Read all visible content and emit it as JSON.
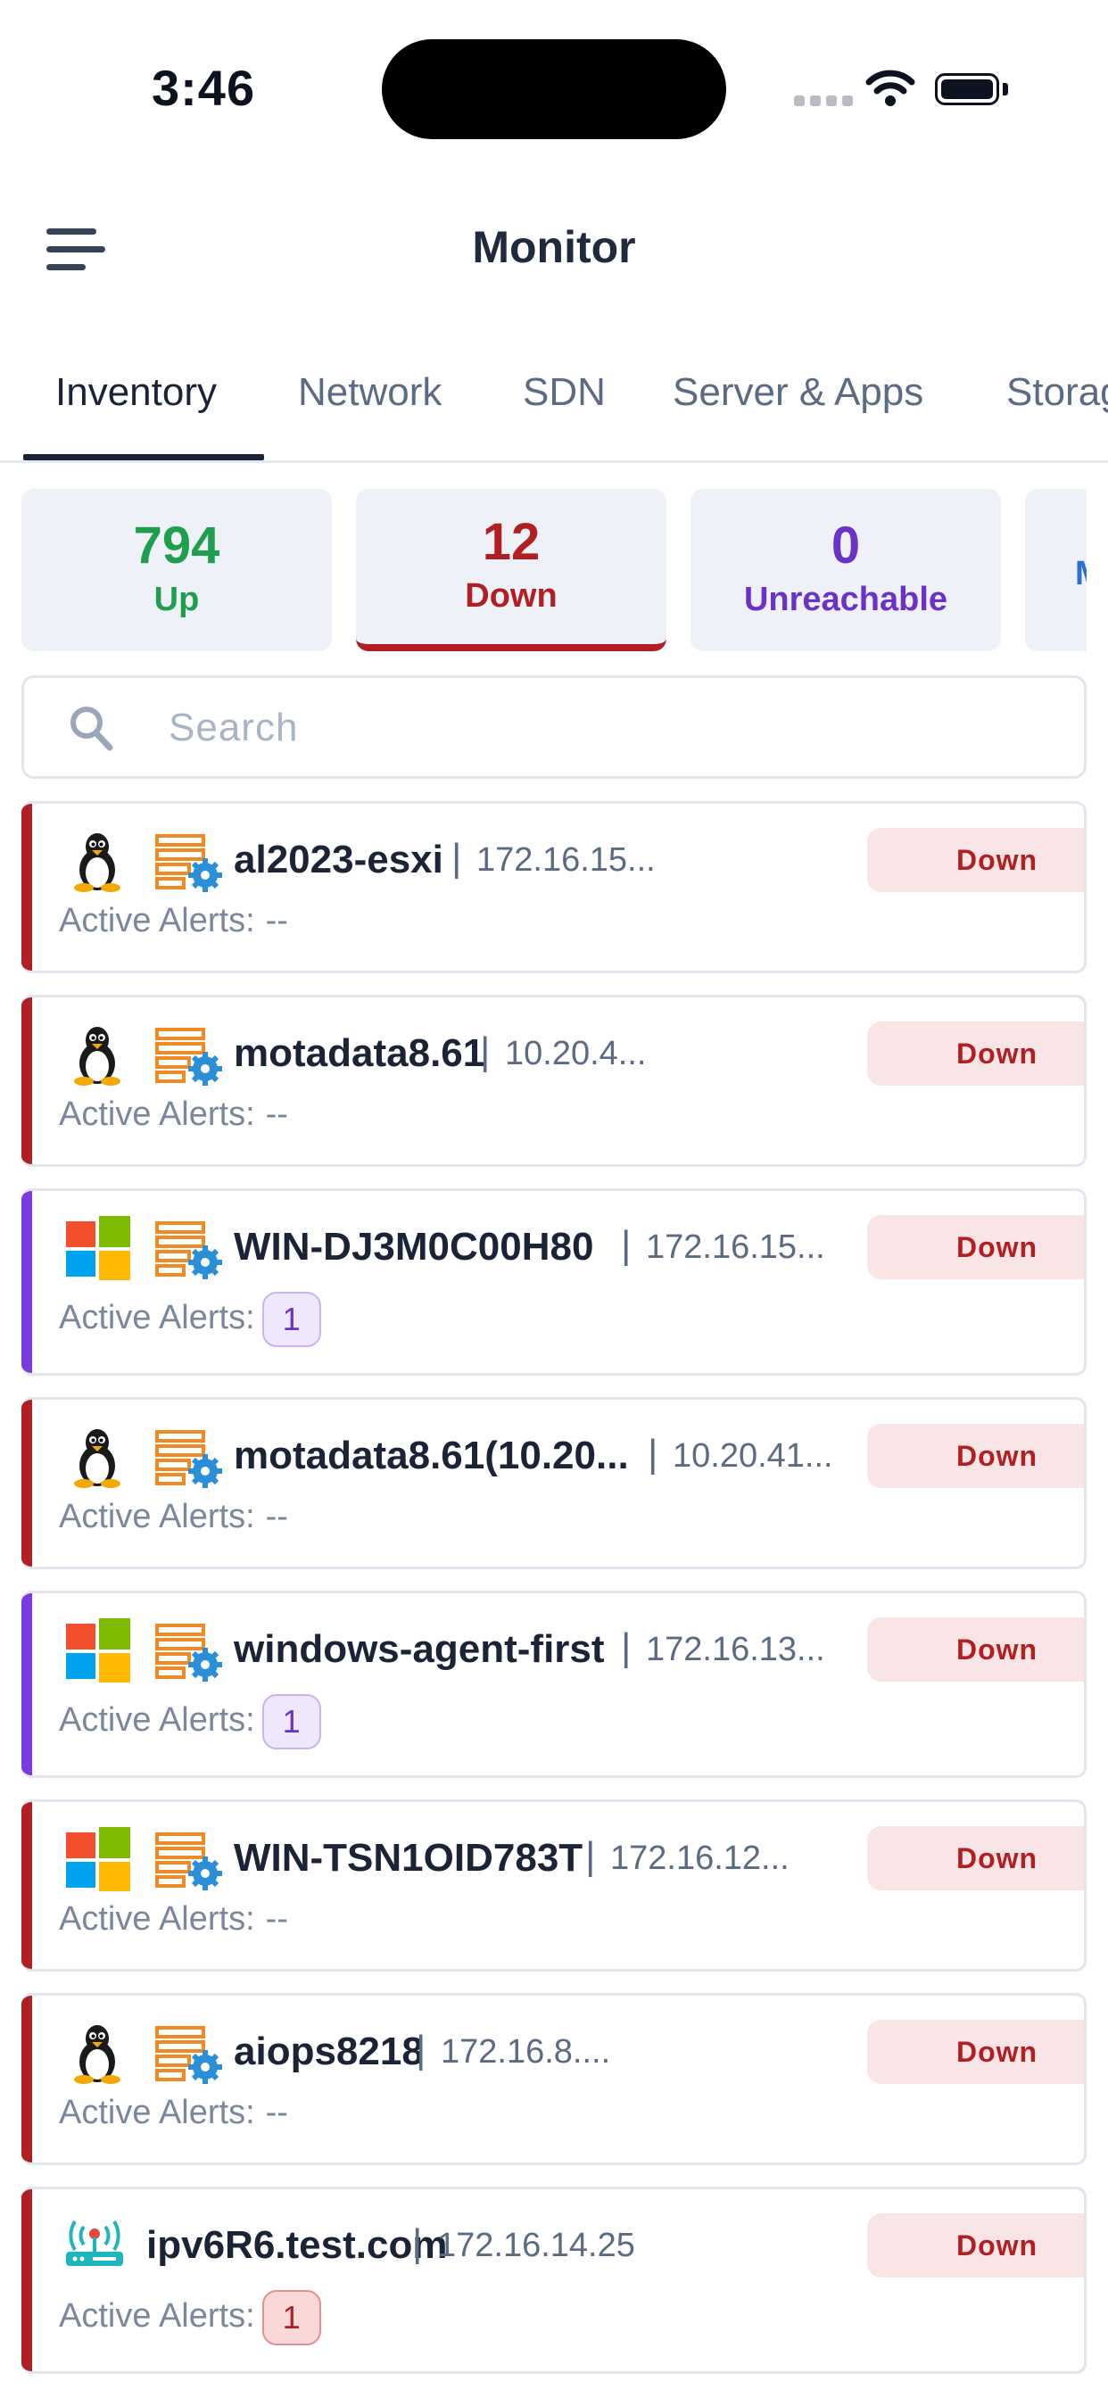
{
  "status_bar": {
    "time": "3:46"
  },
  "header": {
    "title": "Monitor"
  },
  "tabs": [
    {
      "label": "Inventory",
      "active": true
    },
    {
      "label": "Network"
    },
    {
      "label": "SDN"
    },
    {
      "label": "Server & Apps"
    },
    {
      "label": "Storage"
    }
  ],
  "summary": [
    {
      "count": "794",
      "label": "Up",
      "color": "#1e9f4d"
    },
    {
      "count": "12",
      "label": "Down",
      "color": "#b21f22",
      "selected": true
    },
    {
      "count": "0",
      "label": "Unreachable",
      "color": "#6a32c9"
    },
    {
      "count": "",
      "label": "Maintenance",
      "color": "#2d6fd6"
    }
  ],
  "search": {
    "placeholder": "Search"
  },
  "devices": [
    {
      "os": "linux-icon",
      "name": "al2023-esxi",
      "ip": "172.16.15...",
      "status": "Down",
      "alerts_label": "Active Alerts:",
      "alerts": "--",
      "bar_color": "#b21f22"
    },
    {
      "os": "linux-icon",
      "name": "motadata8.61",
      "ip": "10.20.4...",
      "status": "Down",
      "alerts_label": "Active Alerts:",
      "alerts": "--",
      "bar_color": "#b21f22"
    },
    {
      "os": "windows-icon",
      "name": "WIN-DJ3M0C00H80",
      "ip": "172.16.15...",
      "status": "Down",
      "alerts_label": "Active Alerts:",
      "alerts": "1",
      "badge": "purple",
      "bar_color": "#7a3ce0"
    },
    {
      "os": "linux-icon",
      "name": "motadata8.61(10.20...",
      "ip": "10.20.41...",
      "status": "Down",
      "alerts_label": "Active Alerts:",
      "alerts": "--",
      "bar_color": "#b21f22"
    },
    {
      "os": "windows-icon",
      "name": "windows-agent-first",
      "ip": "172.16.13...",
      "status": "Down",
      "alerts_label": "Active Alerts:",
      "alerts": "1",
      "badge": "purple",
      "bar_color": "#7a3ce0"
    },
    {
      "os": "windows-icon",
      "name": "WIN-TSN1OID783T",
      "ip": "172.16.12...",
      "status": "Down",
      "alerts_label": "Active Alerts:",
      "alerts": "--",
      "bar_color": "#b21f22"
    },
    {
      "os": "linux-icon",
      "name": "aiops8218",
      "ip": "172.16.8....",
      "status": "Down",
      "alerts_label": "Active Alerts:",
      "alerts": "--",
      "bar_color": "#b21f22"
    },
    {
      "os": "router-icon",
      "name": "ipv6R6.test.com",
      "ip": "172.16.14.25",
      "status": "Down",
      "alerts_label": "Active Alerts:",
      "alerts": "1",
      "badge": "red",
      "bar_color": "#b21f22"
    }
  ]
}
